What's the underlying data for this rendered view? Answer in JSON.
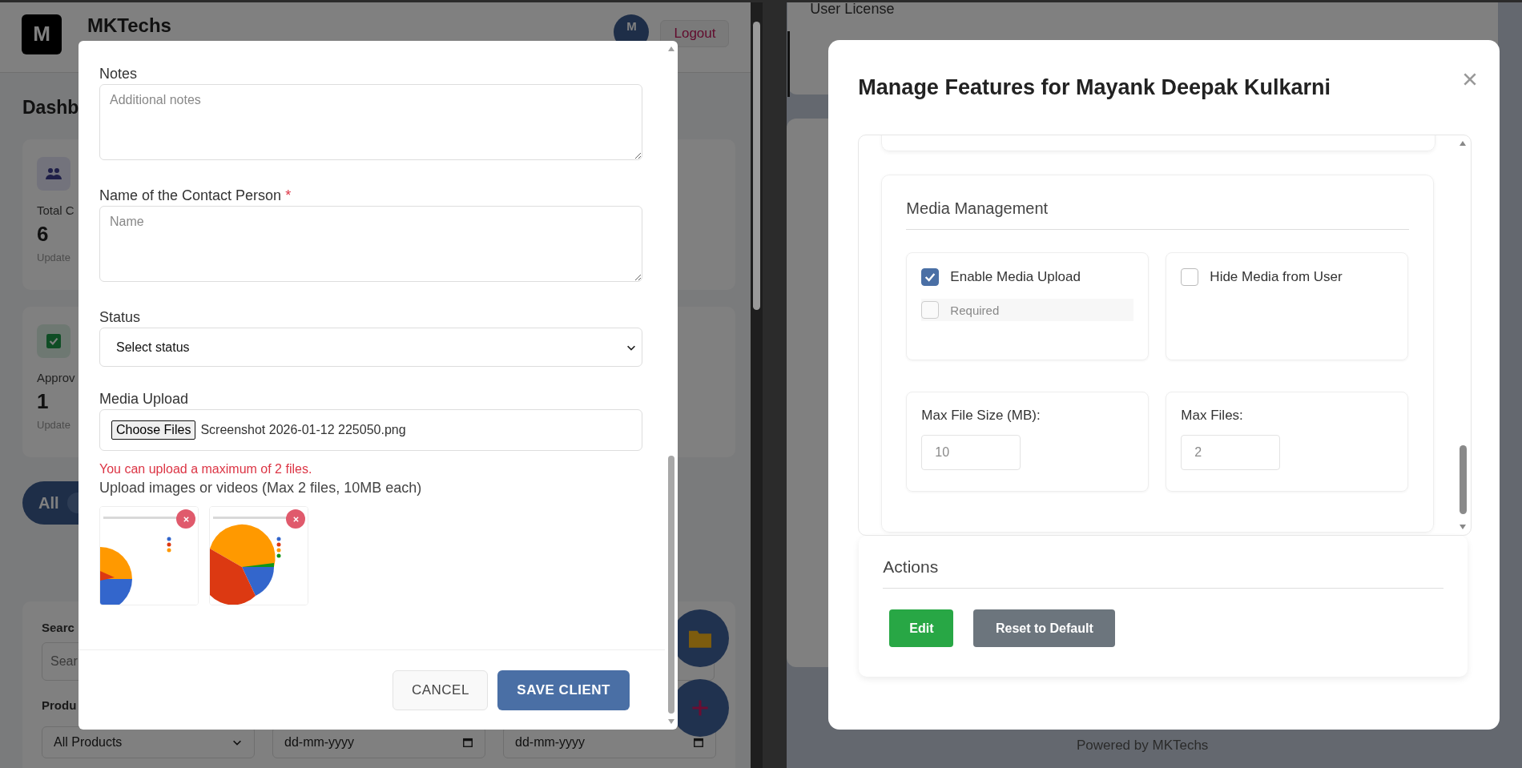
{
  "left_window": {
    "background": {
      "logo": "M",
      "brand": "MKTechs",
      "avatar": "M",
      "logout": "Logout",
      "heading": "Dashb",
      "cards": [
        {
          "kind": "people",
          "label": "Total C",
          "value": "6",
          "note": "Update"
        },
        {
          "kind": "check",
          "label": "Approv",
          "value": "1",
          "note": "Update"
        }
      ],
      "filter_tab": {
        "label": "All",
        "selected": true
      },
      "search": {
        "label": "Searc",
        "placeholder": "Sear"
      },
      "product_label": "Produ",
      "product_select": "All Products",
      "date_from": "dd-mm-yyyy",
      "date_to": "dd-mm-yyyy"
    },
    "modal": {
      "fields": [
        {
          "kind": "textarea",
          "label": "Notes",
          "required": false,
          "placeholder": "Additional notes"
        },
        {
          "kind": "textarea",
          "label": "Name of the Contact Person",
          "required": true,
          "required_mark": "*",
          "placeholder": "Name"
        },
        {
          "kind": "select",
          "label": "Status",
          "required": false,
          "value": "Select status"
        },
        {
          "kind": "file",
          "label": "Media Upload",
          "required": false,
          "button": "Choose Files",
          "value": "Screenshot 2026-01-12 225050.png",
          "error": "You can upload a maximum of 2 files.",
          "help": "Upload images or videos (Max 2 files, 10MB each)"
        }
      ],
      "buttons": [
        {
          "kind": "secondary",
          "label": "CANCEL"
        },
        {
          "kind": "primary",
          "label": "SAVE CLIENT"
        }
      ]
    }
  },
  "right_window": {
    "background": {
      "section": "User License",
      "footer": "Powered by MKTechs"
    },
    "modal": {
      "title": "Manage Features for Mayank Deepak Kulkarni",
      "section": {
        "title": "Media Management",
        "options": [
          {
            "label": "Enable Media Upload",
            "checked": true,
            "sub": {
              "label": "Required",
              "checked": false,
              "disabled": true
            }
          },
          {
            "label": "Hide Media from User",
            "checked": false
          }
        ],
        "limits": [
          {
            "label": "Max File Size (MB):",
            "value": "10",
            "disabled": true
          },
          {
            "label": "Max Files:",
            "value": "2",
            "disabled": true
          }
        ]
      },
      "actions": {
        "title": "Actions",
        "buttons": [
          {
            "kind": "success",
            "label": "Edit"
          },
          {
            "kind": "neutral",
            "label": "Reset to Default"
          }
        ]
      }
    }
  }
}
